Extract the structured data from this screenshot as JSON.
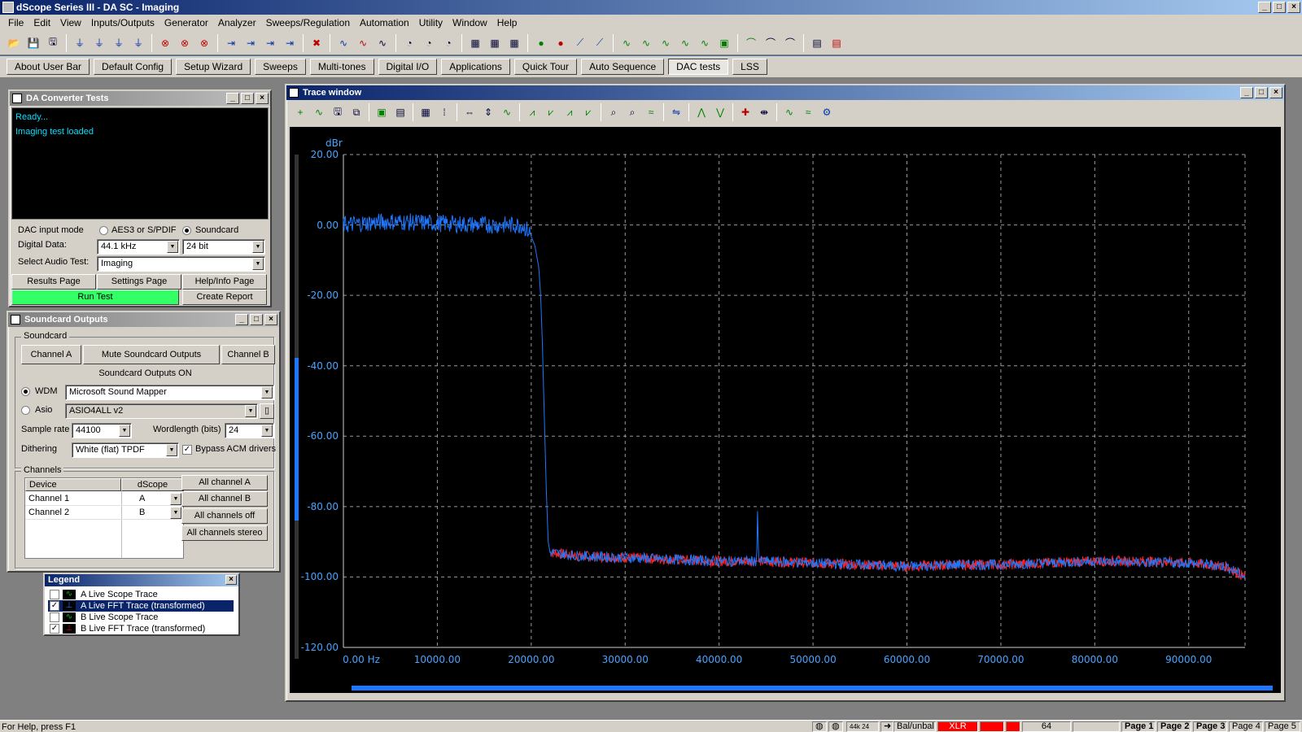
{
  "app": {
    "title": "dScope Series III - DA SC - Imaging"
  },
  "menu": [
    "File",
    "Edit",
    "View",
    "Inputs/Outputs",
    "Generator",
    "Analyzer",
    "Sweeps/Regulation",
    "Automation",
    "Utility",
    "Window",
    "Help"
  ],
  "userbar": [
    "About User Bar",
    "Default Config",
    "Setup Wizard",
    "Sweeps",
    "Multi-tones",
    "Digital I/O",
    "Applications",
    "Quick Tour",
    "Auto Sequence",
    "DAC tests",
    "LSS"
  ],
  "dac": {
    "title": "DA Converter Tests",
    "log": [
      "Ready...",
      "Imaging  test loaded"
    ],
    "input_mode_label": "DAC input mode",
    "opt_aes": "AES3 or S/PDIF",
    "opt_soundcard": "Soundcard",
    "digital_data_label": "Digital Data:",
    "rate": "44.1 kHz",
    "bits": "24 bit",
    "select_test_label": "Select Audio Test:",
    "test": "Imaging",
    "results_page": "Results Page",
    "settings_page": "Settings Page",
    "help_page": "Help/Info Page",
    "run_test": "Run Test",
    "create_report": "Create Report"
  },
  "soundcard": {
    "title": "Soundcard Outputs",
    "group": "Soundcard",
    "channel_a": "Channel A",
    "mute": "Mute Soundcard Outputs",
    "channel_b": "Channel B",
    "status": "Soundcard Outputs ON",
    "wdm_label": "WDM",
    "wdm_value": "Microsoft Sound Mapper",
    "asio_label": "Asio",
    "asio_value": "ASIO4ALL v2",
    "sample_rate_label": "Sample rate",
    "sample_rate": "44100",
    "wordlength_label": "Wordlength (bits)",
    "wordlength": "24",
    "dithering_label": "Dithering",
    "dithering": "White (flat) TPDF",
    "bypass_label": "Bypass ACM drivers",
    "channels_group": "Channels",
    "col_device": "Device",
    "col_dscope": "dScope",
    "rows": [
      {
        "device": "Channel 1",
        "dscope": "A"
      },
      {
        "device": "Channel 2",
        "dscope": "B"
      }
    ],
    "all_a": "All channel A",
    "all_b": "All channel B",
    "all_off": "All channels off",
    "all_stereo": "All channels stereo"
  },
  "legend": {
    "title": "Legend",
    "items": [
      {
        "checked": false,
        "label": "A  Live Scope Trace",
        "color": "#00c000"
      },
      {
        "checked": true,
        "label": "A  Live FFT Trace (transformed)",
        "color": "#1e78ff"
      },
      {
        "checked": false,
        "label": "B  Live Scope Trace",
        "color": "#00c000"
      },
      {
        "checked": true,
        "label": "B  Live FFT Trace (transformed)",
        "color": "#e00000"
      }
    ]
  },
  "trace": {
    "title": "Trace window"
  },
  "chart_data": {
    "type": "line",
    "ylabel": "dBr",
    "xlabel": "",
    "xlim": [
      0,
      96000
    ],
    "ylim": [
      -120,
      20
    ],
    "x_ticks": [
      0,
      10000,
      20000,
      30000,
      40000,
      50000,
      60000,
      70000,
      80000,
      90000
    ],
    "x_tick_labels": [
      "0.00 Hz",
      "10000.00",
      "20000.00",
      "30000.00",
      "40000.00",
      "50000.00",
      "60000.00",
      "70000.00",
      "80000.00",
      "90000.00"
    ],
    "y_ticks": [
      20,
      0,
      -20,
      -40,
      -60,
      -80,
      -100,
      -120
    ],
    "y_tick_labels": [
      "20.00",
      "0.00",
      "-20.00",
      "-40.00",
      "-60.00",
      "-80.00",
      "-100.00",
      "-120.00"
    ],
    "grid": true,
    "background": "#000000",
    "series": [
      {
        "color": "#ff2020",
        "x": [
          22000,
          25000,
          30000,
          35000,
          40000,
          44100,
          50000,
          55000,
          60000,
          65000,
          70000,
          75000,
          80000,
          85000,
          90000,
          94000,
          96000
        ],
        "y": [
          -93,
          -94,
          -94.5,
          -95,
          -95.5,
          -95.5,
          -96,
          -96.5,
          -97,
          -96.5,
          -96.5,
          -96,
          -95.5,
          -95.5,
          -96,
          -97,
          -100
        ]
      },
      {
        "color": "#1e78ff",
        "x": [
          0,
          2000,
          5000,
          10000,
          15000,
          19000,
          19800,
          20400,
          20800,
          21000,
          21200,
          21400,
          21600,
          21800,
          22000,
          25000,
          30000,
          35000,
          40000,
          44000,
          44100,
          44200,
          50000,
          55000,
          60000,
          65000,
          70000,
          75000,
          80000,
          85000,
          90000,
          94000,
          96000
        ],
        "y": [
          0,
          0.5,
          1,
          0.5,
          0,
          0,
          -2,
          -6,
          -12,
          -20,
          -35,
          -55,
          -75,
          -90,
          -93,
          -94,
          -94.5,
          -95,
          -95.5,
          -95.5,
          -80,
          -95.5,
          -96,
          -96.5,
          -97,
          -96.5,
          -96.5,
          -96,
          -95.5,
          -96,
          -96,
          -97,
          -100
        ]
      }
    ]
  },
  "status": {
    "help": "For Help, press F1",
    "rate_badge": "44k 24",
    "balance": "Bal/unbal",
    "xlr": "XLR",
    "n": "64",
    "pages": [
      "Page 1",
      "Page 2",
      "Page 3",
      "Page 4",
      "Page 5"
    ]
  }
}
